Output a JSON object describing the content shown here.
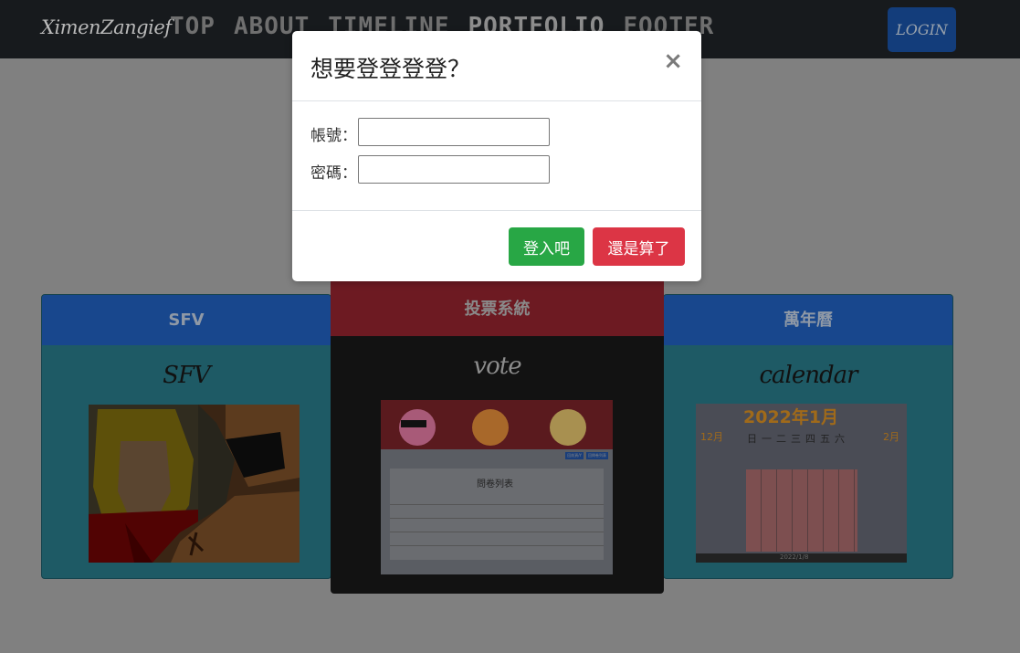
{
  "navbar": {
    "brand": "XimenZangief",
    "links": [
      "TOP",
      "ABOUT",
      "TIMELINE",
      "PORTFOLIO",
      "FOOTER"
    ],
    "login_label": "LOGIN"
  },
  "portfolio": {
    "cards": [
      {
        "header": "SFV",
        "title": "SFV"
      },
      {
        "header": "投票系統",
        "title": "vote"
      },
      {
        "header": "萬年曆",
        "title": "calendar"
      }
    ],
    "vote_preview": {
      "heading": "問卷列表",
      "buttons": [
        "回前頁/Y",
        "回問卷列表"
      ]
    },
    "calendar_preview": {
      "heading": "2022年1月",
      "prev": "12月",
      "next": "2月",
      "weekdays": [
        "日",
        "一",
        "二",
        "三",
        "四",
        "五",
        "六"
      ],
      "footer": "2022/1/8"
    }
  },
  "modal": {
    "title": "想要登登登登？",
    "close": "×",
    "username_label": "帳號：",
    "password_label": "密碼：",
    "username_value": "",
    "password_value": "",
    "confirm_label": "登入吧",
    "cancel_label": "還是算了"
  }
}
